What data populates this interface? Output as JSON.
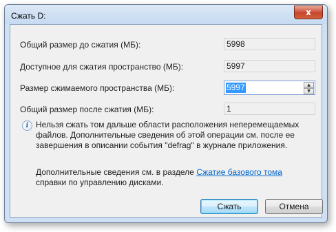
{
  "window": {
    "title": "Сжать D:",
    "close_label": "x"
  },
  "fields": {
    "total_size": {
      "label": "Общий размер до сжатия (МБ):",
      "value": "5998"
    },
    "available": {
      "label": "Доступное для сжатия пространство (МБ):",
      "value": "5997"
    },
    "shrink_amount": {
      "label": "Размер сжимаемого пространства (МБ):",
      "value": "5997"
    },
    "after_size": {
      "label": "Общий размер после сжатия (МБ):",
      "value": "1"
    }
  },
  "spin": {
    "up": "▲",
    "down": "▼"
  },
  "info": {
    "icon": "i",
    "text": "Нельзя сжать том дальше области расположения неперемещаемых файлов. Дополнительные сведения об этой операции см. после ее завершения в описании события \"defrag\" в журнале приложения."
  },
  "help": {
    "prefix": "Дополнительные сведения см. в разделе ",
    "link": "Сжатие базового тома",
    "suffix": " справки по управлению дисками."
  },
  "buttons": {
    "shrink": "Сжать",
    "cancel": "Отмена"
  }
}
